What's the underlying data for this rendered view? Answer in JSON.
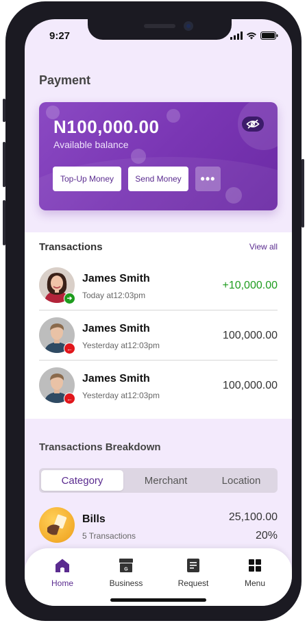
{
  "status_bar": {
    "time": "9:27"
  },
  "page": {
    "title": "Payment"
  },
  "balance_card": {
    "balance": "N100,000.00",
    "balance_label": "Available balance",
    "top_up_label": "Top-Up Money",
    "send_label": "Send Money",
    "more_label": "•••"
  },
  "transactions": {
    "title": "Transactions",
    "view_all": "View all",
    "items": [
      {
        "name": "James Smith",
        "time": "Today at12:03pm",
        "amount": "+10,000.00",
        "direction": "in"
      },
      {
        "name": "James Smith",
        "time": "Yesterday at12:03pm",
        "amount": "100,000.00",
        "direction": "out"
      },
      {
        "name": "James Smith",
        "time": "Yesterday at12:03pm",
        "amount": "100,000.00",
        "direction": "out"
      }
    ]
  },
  "breakdown": {
    "title": "Transactions Breakdown",
    "tabs": [
      "Category",
      "Merchant",
      "Location"
    ],
    "active_tab": "Category",
    "items": [
      {
        "name": "Bills",
        "count": "5 Transactions",
        "amount": "25,100.00",
        "percent": "20%"
      }
    ]
  },
  "bottom_nav": {
    "items": [
      {
        "label": "Home",
        "icon": "home-icon",
        "active": true
      },
      {
        "label": "Business",
        "icon": "store-icon",
        "active": false
      },
      {
        "label": "Request",
        "icon": "document-icon",
        "active": false
      },
      {
        "label": "Menu",
        "icon": "grid-icon",
        "active": false
      }
    ]
  },
  "colors": {
    "brand_purple": "#7a36b4",
    "accent_text": "#5a2b8f",
    "positive": "#1e9c1e",
    "negative": "#e0161b",
    "screen_bg": "#f3eafc"
  }
}
